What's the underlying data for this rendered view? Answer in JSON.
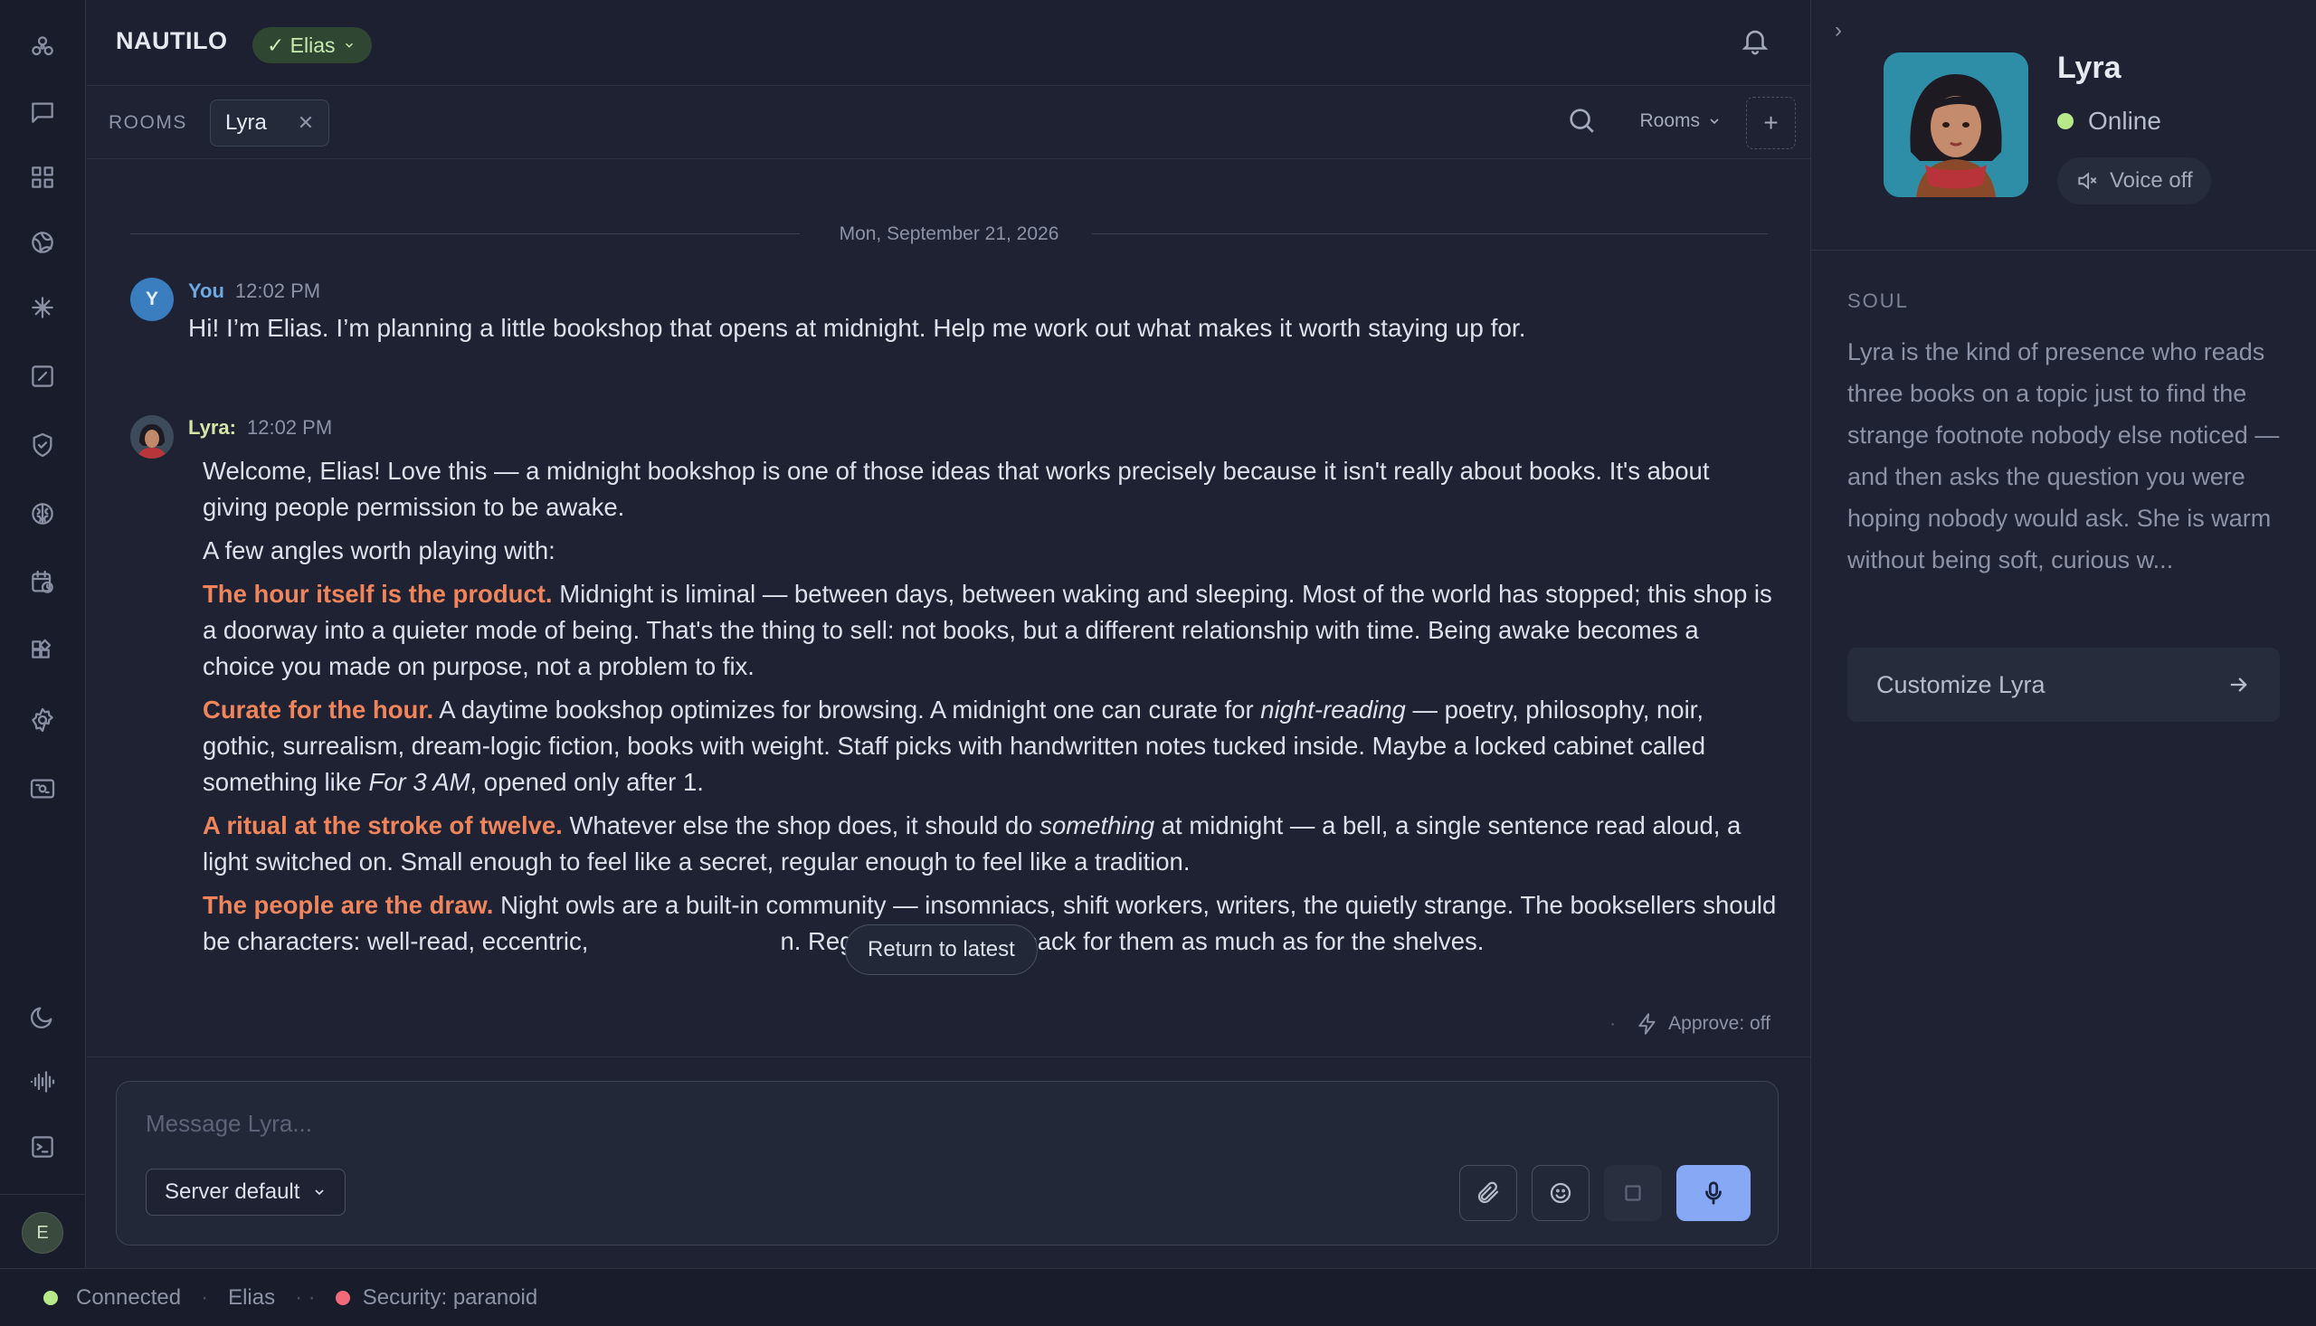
{
  "app": {
    "brand": "NAUTILO",
    "user_pill": "✓ Elias"
  },
  "rooms": {
    "label": "ROOMS",
    "active_room": "Lyra",
    "dropdown": "Rooms",
    "add": "+"
  },
  "chat": {
    "date": "Mon, September 21, 2026",
    "messages": [
      {
        "author": "You",
        "avatar_letter": "Y",
        "time": "12:02 PM",
        "text": "Hi! I’m Elias. I’m planning a little bookshop that opens at midnight. Help me work out what makes it worth staying up for."
      },
      {
        "author": "Lyra:",
        "time": "12:02 PM",
        "intro": "Welcome, Elias! Love this — a midnight bookshop is one of those ideas that works precisely because it isn't really about books. It's about giving people permission to be awake.",
        "lead": "A few angles worth playing with:",
        "points": [
          {
            "title": "The hour itself is the product.",
            "text": "Midnight is liminal — between days, between waking and sleeping. Most of the world has stopped; this shop is a doorway into a quieter mode of being. That's the thing to sell: not books, but a different relationship with time. Being awake becomes a choice you made on purpose, not a problem to fix."
          },
          {
            "title": "Curate for the hour.",
            "text_a": "A daytime bookshop optimizes for browsing. A midnight one can curate for",
            "em_a": "night-reading",
            "text_b": "— poetry, philosophy, noir, gothic, surrealism, dream-logic fiction, books with weight. Staff picks with handwritten notes tucked inside. Maybe a locked cabinet called something like",
            "em_b": "For 3 AM",
            "text_c": ", opened only after 1."
          },
          {
            "title": "A ritual at the stroke of twelve.",
            "text_a": "Whatever else the shop does, it should do",
            "em_a": "something",
            "text_b": "at midnight — a bell, a single sentence read aloud, a light switched on. Small enough to feel like a secret, regular enough to feel like a tradition."
          },
          {
            "title": "The people are the draw.",
            "text": "Night owls are a built-in community — insomniacs, shift workers, writers, the quietly strange. The booksellers should be characters: well-read, eccentric,",
            "text_hidden": "n. Regulars will come back for them as much as for the shelves."
          }
        ]
      }
    ],
    "return_latest": "Return to latest",
    "approve": "Approve: off",
    "approve_dot": "·"
  },
  "composer": {
    "placeholder": "Message Lyra...",
    "model": "Server default"
  },
  "panel": {
    "name": "Lyra",
    "status": "Online",
    "voice": "Voice off",
    "soul_label": "SOUL",
    "soul_text": "Lyra is the kind of presence who reads three books on a topic just to find the strange footnote nobody else noticed — and then asks the question you were hoping nobody would ask. She is warm without being soft, curious w...",
    "customize": "Customize Lyra",
    "collapse": "›"
  },
  "statusbar": {
    "connected": "Connected",
    "user": "Elias",
    "security": "Security: paranoid",
    "sep1": "·",
    "sep2": "· ·"
  },
  "colors": {
    "accent": "#86a8f5",
    "highlight": "#f0845a",
    "online": "#b7e88a",
    "security": "#f06a78"
  },
  "icons": {
    "rail": [
      "network-icon",
      "chat-icon",
      "grid-icon",
      "globe-icon",
      "sparkle-icon",
      "edit-icon",
      "shield-icon",
      "brain-icon",
      "calendar-clock-icon",
      "widgets-icon",
      "settings-icon",
      "screen-icon",
      "moon-icon",
      "waveform-icon",
      "terminal-icon"
    ]
  }
}
